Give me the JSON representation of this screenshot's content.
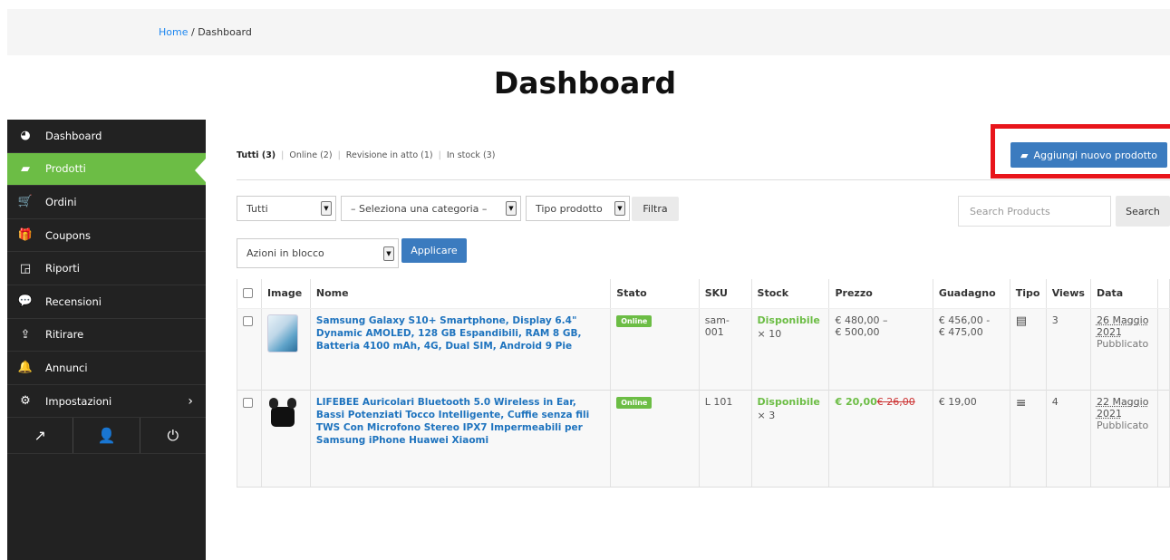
{
  "breadcrumb": {
    "home": "Home",
    "separator": " / ",
    "current": "Dashboard"
  },
  "page_title": "Dashboard",
  "sidebar": {
    "items": [
      {
        "label": "Dashboard",
        "icon": "dashboard-icon",
        "glyph": "◕"
      },
      {
        "label": "Prodotti",
        "icon": "briefcase-icon",
        "glyph": "▰",
        "active": true
      },
      {
        "label": "Ordini",
        "icon": "cart-icon",
        "glyph": "🛒"
      },
      {
        "label": "Coupons",
        "icon": "gift-icon",
        "glyph": "🎁"
      },
      {
        "label": "Riporti",
        "icon": "chart-icon",
        "glyph": "◲"
      },
      {
        "label": "Recensioni",
        "icon": "comments-icon",
        "glyph": "💬"
      },
      {
        "label": "Ritirare",
        "icon": "upload-icon",
        "glyph": "⇪"
      },
      {
        "label": "Annunci",
        "icon": "bell-icon",
        "glyph": "🔔"
      },
      {
        "label": "Impostazioni",
        "icon": "gear-icon",
        "glyph": "⚙",
        "chevron": "›"
      }
    ],
    "footer_icons": [
      {
        "name": "external-link-icon",
        "glyph": "↗"
      },
      {
        "name": "user-icon",
        "glyph": "👤"
      },
      {
        "name": "power-icon",
        "glyph": "⏻"
      }
    ]
  },
  "status_filters": {
    "all": "Tutti (3)",
    "online": "Online (2)",
    "review": "Revisione in atto (1)",
    "in_stock": "In stock (3)",
    "separator": "|"
  },
  "add_product_label": "Aggiungi nuovo prodotto",
  "filters": {
    "all_select": "Tutti",
    "category_select": "– Seleziona una categoria –",
    "type_select": "Tipo prodotto",
    "filter_button": "Filtra",
    "bulk_select": "Azioni in blocco",
    "apply_button": "Applicare",
    "search_placeholder": "Search Products",
    "search_button": "Search"
  },
  "table": {
    "headers": [
      "Image",
      "Nome",
      "Stato",
      "SKU",
      "Stock",
      "Prezzo",
      "Guadagno",
      "Tipo",
      "Views",
      "Data"
    ],
    "rows": [
      {
        "name": "Samsung Galaxy S10+ Smartphone, Display 6.4\" Dynamic AMOLED, 128 GB Espandibili, RAM 8 GB, Batteria 4100 mAh, 4G, Dual SIM, Android 9 Pie",
        "status": "Online",
        "sku": "sam-001",
        "stock_label": "Disponibile",
        "stock_qty": "× 10",
        "price_line1": "€ 480,00 –",
        "price_line2": "€ 500,00",
        "earning_line1": "€ 456,00 -",
        "earning_line2": "€ 475,00",
        "type_icon": "variable-product-icon",
        "type_glyph": "▤",
        "views": "3",
        "date": "26 Maggio 2021",
        "date_status": "Pubblicato"
      },
      {
        "name": "LIFEBEE Auricolari Bluetooth 5.0 Wireless in Ear, Bassi Potenziati Tocco Intelligente, Cuffie senza fili TWS Con Microfono Stereo IPX7 Impermeabili per Samsung iPhone Huawei Xiaomi",
        "status": "Online",
        "sku": "L 101",
        "stock_label": "Disponibile",
        "stock_qty": "× 3",
        "price_sale": "€ 20,00",
        "price_old": "€ 26,00",
        "earning": "€ 19,00",
        "type_icon": "simple-product-icon",
        "type_glyph": "≡",
        "views": "4",
        "date": "22 Maggio 2021",
        "date_status": "Pubblicato"
      }
    ]
  },
  "colors": {
    "accent_green": "#6cbd45",
    "primary_blue": "#3b7bbf",
    "link_blue": "#1e73be",
    "highlight_red": "#e8151b",
    "sidebar_bg": "#222222"
  }
}
